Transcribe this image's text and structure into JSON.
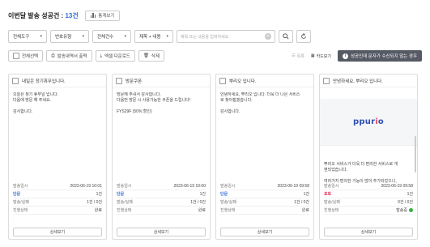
{
  "header": {
    "title_prefix": "이번달 발송 성공건 : ",
    "count": "13건",
    "stats_button": "통계보기"
  },
  "filters": {
    "selects": [
      "전체도구",
      "번호유형",
      "전체건수",
      "제목 + 내용"
    ],
    "search_placeholder": "제목 또는 내용을 입력하세요"
  },
  "toolbar": {
    "select_all": "전체선택",
    "print": "발송내역서 출력",
    "excel": "엑셀 다운로드",
    "delete": "삭제",
    "view_list": "목록",
    "view_card": "카드보기",
    "warn": "성공인데 문자가 수신되지 않는 경우"
  },
  "labels": {
    "send_date": "발송일시",
    "send_count": "발송/실패",
    "status": "진행상태",
    "detail": "상세보기"
  },
  "cards": [
    {
      "title": "내일은 정기휴무입니다.",
      "body": "오늘은 정기 휴무일 입니다.\n다음에 방문 해 주세요.\n\n감사합니다.",
      "date": "2023-06-19 10:01",
      "type": "단문",
      "count": "1건",
      "result": "1건 / 0건",
      "status": "완료"
    },
    {
      "title": "방문쿠폰",
      "body": "방문해 주셔서 감사합니다.\n다음번 방문 시 사용가능한 쿠폰을 드립니다!\n\nFYS29F (50% 할인)",
      "date": "2023-06-19 10:00",
      "type": "단문",
      "count": "1건",
      "result": "1건 / 0건",
      "status": "완료"
    },
    {
      "title": "뿌리오 입니다.",
      "body": "안녕하세요, 뿌리오 입니다. 더욱 더 나은 서비스\n로 찾아뵙겠습니다.\n\n감사합니다.",
      "date": "2023-06-19 09:58",
      "type": "단문",
      "count": "1건",
      "result": "1건 / 0건",
      "status": "완료"
    },
    {
      "title": "안녕하세요, 뿌리오 입니다.",
      "logo": "ppurio",
      "body": "뿌리오 서비스가 더욱 더 편리한 서비스로 개\n편되었습니다.\n\n여러가지 편의한 기능이 많이 추가되었으니,\n여러분께 많은 이용 부탁 드립니다.",
      "date": "2023-06-19 09:58",
      "type": "포토",
      "count": "1건",
      "result": "0건 / 0건",
      "status": "발송중"
    }
  ],
  "colors": {
    "accent": "#2f6fd6",
    "photo_tag": "#e0315a",
    "sending_dot": "#3cb043",
    "warn_bg": "#555a64"
  }
}
